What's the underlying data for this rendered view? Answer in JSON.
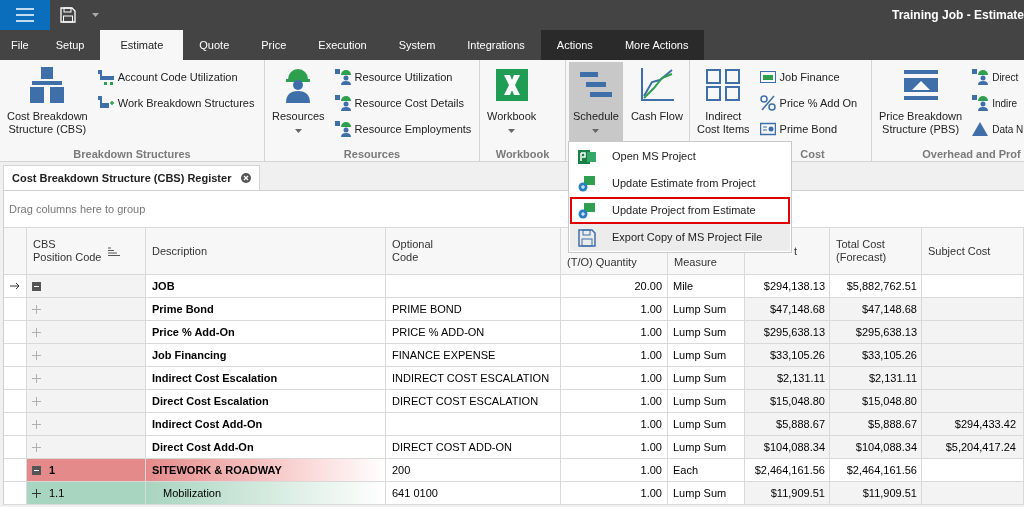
{
  "window": {
    "title": "Training Job - Estimate"
  },
  "menu_tabs": [
    {
      "label": "File",
      "selected": false,
      "kind": "normal"
    },
    {
      "label": "Setup",
      "selected": false,
      "kind": "normal"
    },
    {
      "label": "Estimate",
      "selected": true,
      "kind": "normal"
    },
    {
      "label": "Quote",
      "selected": false,
      "kind": "normal"
    },
    {
      "label": "Price",
      "selected": false,
      "kind": "normal"
    },
    {
      "label": "Execution",
      "selected": false,
      "kind": "normal"
    },
    {
      "label": "System",
      "selected": false,
      "kind": "normal"
    },
    {
      "label": "Integrations",
      "selected": false,
      "kind": "normal"
    },
    {
      "label": "Actions",
      "selected": false,
      "kind": "context"
    },
    {
      "label": "More Actions",
      "selected": false,
      "kind": "context"
    }
  ],
  "ribbon_groups": [
    {
      "label": "Breakdown Structures",
      "large": [
        {
          "label": "Cost Breakdown\nStructure (CBS)",
          "dropdown": false,
          "pressed": false
        }
      ],
      "small": [
        "Account Code Utilization",
        "Work Breakdown Structures"
      ]
    },
    {
      "label": "Resources",
      "large": [
        {
          "label": "Resources",
          "dropdown": true,
          "pressed": false
        }
      ],
      "small": [
        "Resource Utilization",
        "Resource Cost Details",
        "Resource Employments"
      ]
    },
    {
      "label": "Workbook",
      "large": [
        {
          "label": "Workbook",
          "dropdown": true,
          "pressed": false
        }
      ]
    },
    {
      "large": [
        {
          "label": "Schedule",
          "dropdown": true,
          "pressed": true
        },
        {
          "label": "Cash Flow",
          "dropdown": false,
          "pressed": false
        }
      ]
    },
    {
      "label": "Cost",
      "large": [
        {
          "label": "Indirect\nCost Items",
          "dropdown": false,
          "pressed": false
        }
      ],
      "small": [
        "Job Finance",
        "Price % Add On",
        "Prime Bond"
      ]
    },
    {
      "label": "Overhead and Prof",
      "large": [
        {
          "label": "Price Breakdown\nStructure (PBS)",
          "dropdown": false,
          "pressed": false
        }
      ],
      "small": [
        "Direct",
        "Indire",
        "Data N"
      ]
    }
  ],
  "schedule_menu": [
    {
      "label": "Open MS Project",
      "highlighted": false,
      "hovered": false
    },
    {
      "label": "Update Estimate from Project",
      "highlighted": false,
      "hovered": false
    },
    {
      "label": "Update Project from Estimate",
      "highlighted": true,
      "hovered": false
    },
    {
      "label": "Export Copy of MS Project File",
      "highlighted": false,
      "hovered": true
    }
  ],
  "document_tab": {
    "title": "Cost Breakdown Structure (CBS) Register"
  },
  "group_panel": {
    "placeholder": "Drag columns here to group"
  },
  "table": {
    "columns": [
      "CBS\nPosition Code",
      "Description",
      "Optional\nCode",
      "(T/O) Quantity",
      "Measure",
      "t",
      "Total Cost\n(Forecast)",
      "Subject Cost"
    ],
    "rows": [
      {
        "kind": "job",
        "focused": true,
        "expanded": true,
        "code": "",
        "description": "JOB",
        "optional_code": "",
        "quantity": "20.00",
        "measure": "Mile",
        "total_cost": "$294,138.13",
        "forecast": "$5,882,762.51",
        "subject_cost": ""
      },
      {
        "kind": "addon",
        "focused": false,
        "expanded": false,
        "code": "",
        "description": "Prime Bond",
        "optional_code": "PRIME BOND",
        "quantity": "1.00",
        "measure": "Lump Sum",
        "total_cost": "$47,148.68",
        "forecast": "$47,148.68",
        "subject_cost": ""
      },
      {
        "kind": "addon",
        "focused": false,
        "expanded": false,
        "code": "",
        "description": "Price % Add-On",
        "optional_code": "PRICE % ADD-ON",
        "quantity": "1.00",
        "measure": "Lump Sum",
        "total_cost": "$295,638.13",
        "forecast": "$295,638.13",
        "subject_cost": ""
      },
      {
        "kind": "addon",
        "focused": false,
        "expanded": false,
        "code": "",
        "description": "Job Financing",
        "optional_code": "FINANCE EXPENSE",
        "quantity": "1.00",
        "measure": "Lump Sum",
        "total_cost": "$33,105.26",
        "forecast": "$33,105.26",
        "subject_cost": ""
      },
      {
        "kind": "addon",
        "focused": false,
        "expanded": false,
        "code": "",
        "description": "Indirect Cost Escalation",
        "optional_code": "INDIRECT COST ESCALATION",
        "quantity": "1.00",
        "measure": "Lump Sum",
        "total_cost": "$2,131.11",
        "forecast": "$2,131.11",
        "subject_cost": ""
      },
      {
        "kind": "addon",
        "focused": false,
        "expanded": false,
        "code": "",
        "description": "Direct Cost Escalation",
        "optional_code": "DIRECT COST ESCALATION",
        "quantity": "1.00",
        "measure": "Lump Sum",
        "total_cost": "$15,048.80",
        "forecast": "$15,048.80",
        "subject_cost": ""
      },
      {
        "kind": "addon",
        "focused": false,
        "expanded": false,
        "code": "",
        "description": "Indirect Cost Add-On",
        "optional_code": "",
        "quantity": "1.00",
        "measure": "Lump Sum",
        "total_cost": "$5,888.67",
        "forecast": "$5,888.67",
        "subject_cost": "$294,433.42"
      },
      {
        "kind": "addon",
        "focused": false,
        "expanded": false,
        "code": "",
        "description": "Direct Cost Add-On",
        "optional_code": "DIRECT COST ADD-ON",
        "quantity": "1.00",
        "measure": "Lump Sum",
        "total_cost": "$104,088.34",
        "forecast": "$104,088.34",
        "subject_cost": "$5,204,417.24"
      },
      {
        "kind": "section",
        "focused": false,
        "expanded": true,
        "code": "1",
        "description": "SITEWORK & ROADWAY",
        "optional_code": "200",
        "quantity": "1.00",
        "measure": "Each",
        "total_cost": "$2,464,161.56",
        "forecast": "$2,464,161.56",
        "subject_cost": ""
      },
      {
        "kind": "item",
        "focused": false,
        "expanded": false,
        "code": "1.1",
        "description": "Mobilization",
        "optional_code": "641 0100",
        "quantity": "1.00",
        "measure": "Lump Sum",
        "total_cost": "$11,909.51",
        "forecast": "$11,909.51",
        "subject_cost": ""
      }
    ]
  }
}
